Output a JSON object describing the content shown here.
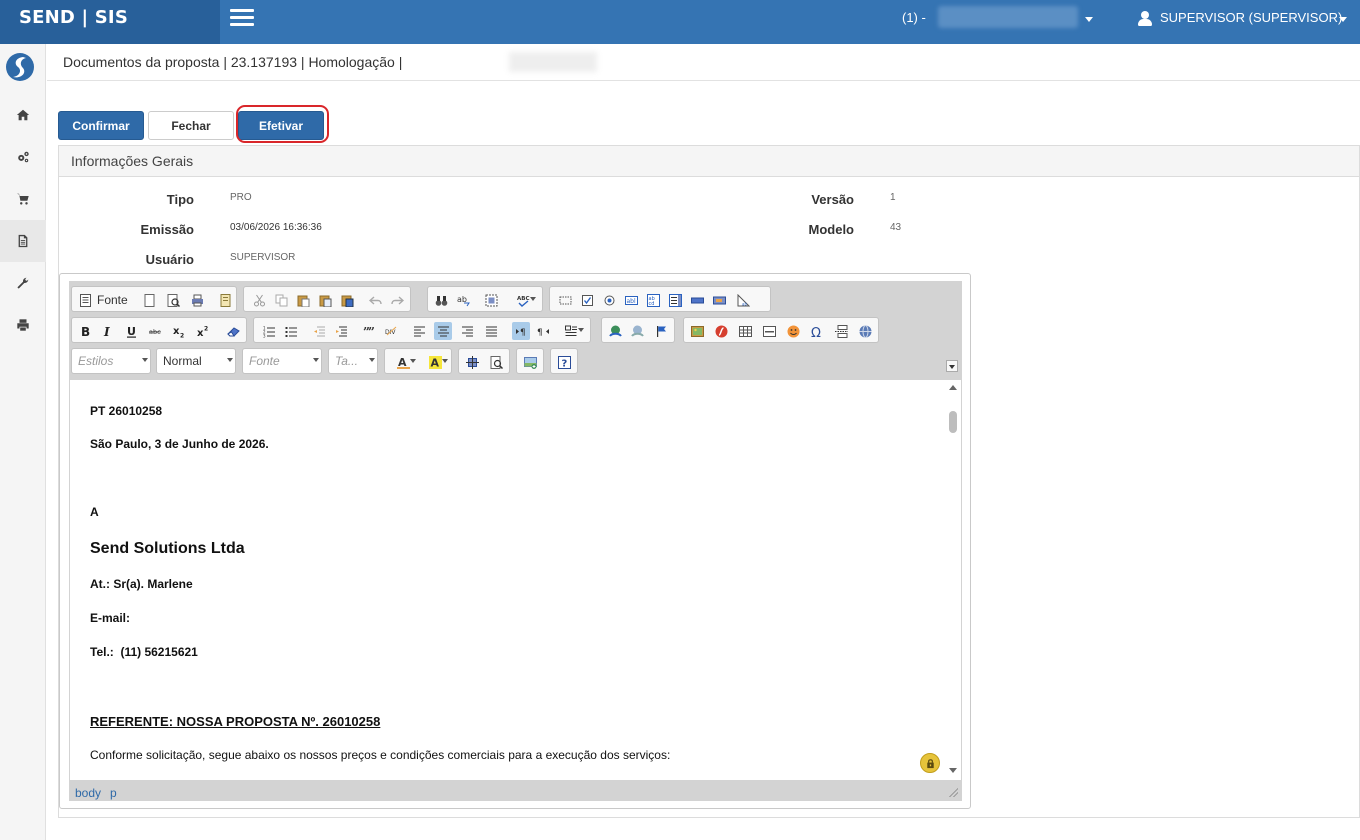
{
  "app": {
    "brand": "SEND | SIS"
  },
  "header": {
    "company_prefix": "(1) -",
    "user_label": "SUPERVISOR (SUPERVISOR)"
  },
  "breadcrumb": {
    "text": "Documentos da proposta | 23.137193 | Homologação |"
  },
  "actions": {
    "confirm": "Confirmar",
    "close": "Fechar",
    "apply": "Efetivar"
  },
  "panel": {
    "title": "Informações Gerais"
  },
  "fields": {
    "tipo_label": "Tipo",
    "tipo_value": "PRO",
    "emissao_label": "Emissão",
    "emissao_value": "03/06/2026 16:36:36",
    "usuario_label": "Usuário",
    "usuario_value": "SUPERVISOR",
    "versao_label": "Versão",
    "versao_value": "1",
    "modelo_label": "Modelo",
    "modelo_value": "43"
  },
  "editor": {
    "source_label": "Fonte",
    "combos": {
      "styles": "Estilos",
      "format": "Normal",
      "font": "Fonte",
      "size": "Ta..."
    },
    "status_path": [
      "body",
      "p"
    ]
  },
  "document": {
    "ref": "PT 26010258",
    "date_line": "São Paulo, 3 de Junho de 2026.",
    "to": "A",
    "company": "Send Solutions Ltda",
    "attention": "At.: Sr(a). Marlene",
    "email": "E-mail:",
    "phone": "Tel.:  (11) 56215621",
    "subject": "REFERENTE: NOSSA PROPOSTA Nº. 26010258",
    "intro": "Conforme solicitação, segue abaixo os nossos preços e condições comerciais para a execução dos serviços:"
  },
  "colors": {
    "topbar": "#3574b3",
    "brand_bg": "#28609a",
    "primary": "#2f6aa8",
    "highlight": "#d9262a"
  }
}
